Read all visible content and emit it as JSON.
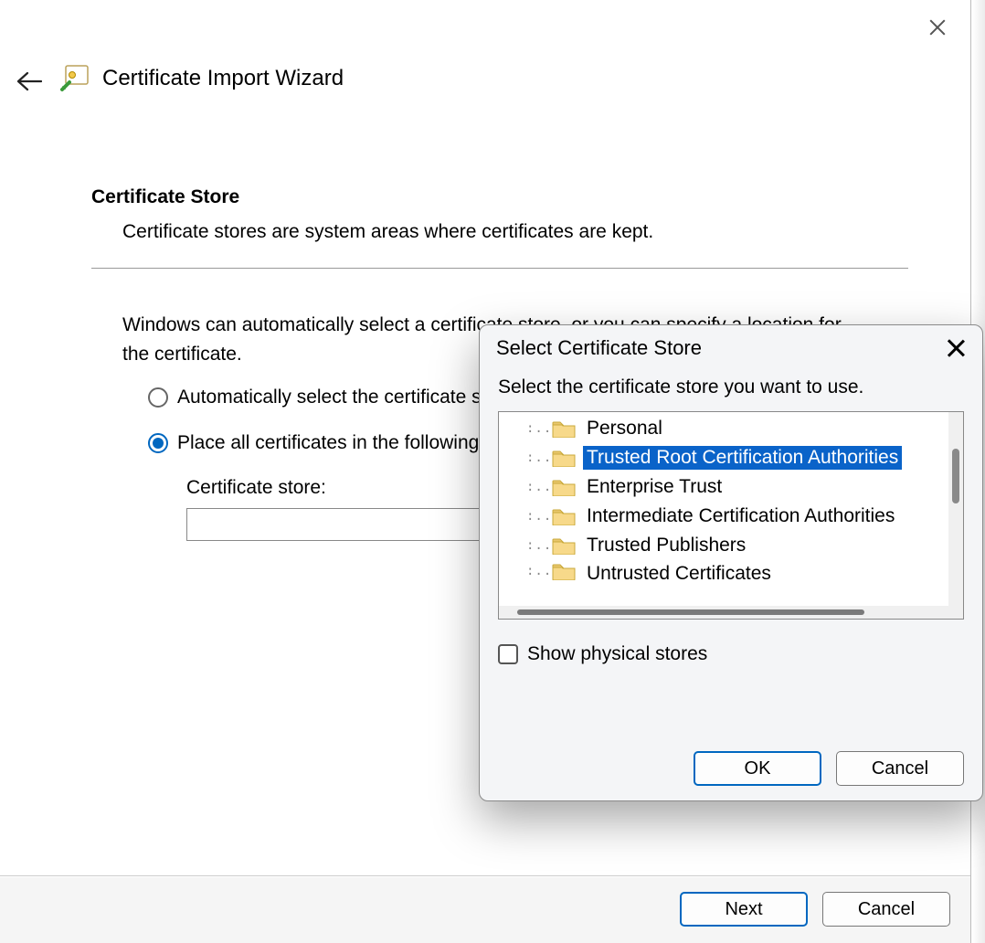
{
  "wizard": {
    "title": "Certificate Import Wizard",
    "section_heading": "Certificate Store",
    "section_sub": "Certificate stores are system areas where certificates are kept.",
    "body_text": "Windows can automatically select a certificate store, or you can specify a location for the certificate.",
    "radio_auto": "Automatically select the certificate store based on the type of certificate",
    "radio_place": "Place all certificates in the following store",
    "store_label": "Certificate store:",
    "store_value": "",
    "next": "Next",
    "cancel": "Cancel"
  },
  "dialog": {
    "title": "Select Certificate Store",
    "instruction": "Select the certificate store you want to use.",
    "items": [
      "Personal",
      "Trusted Root Certification Authorities",
      "Enterprise Trust",
      "Intermediate Certification Authorities",
      "Trusted Publishers",
      "Untrusted Certificates"
    ],
    "selected_index": 1,
    "show_physical": "Show physical stores",
    "ok": "OK",
    "cancel": "Cancel"
  }
}
